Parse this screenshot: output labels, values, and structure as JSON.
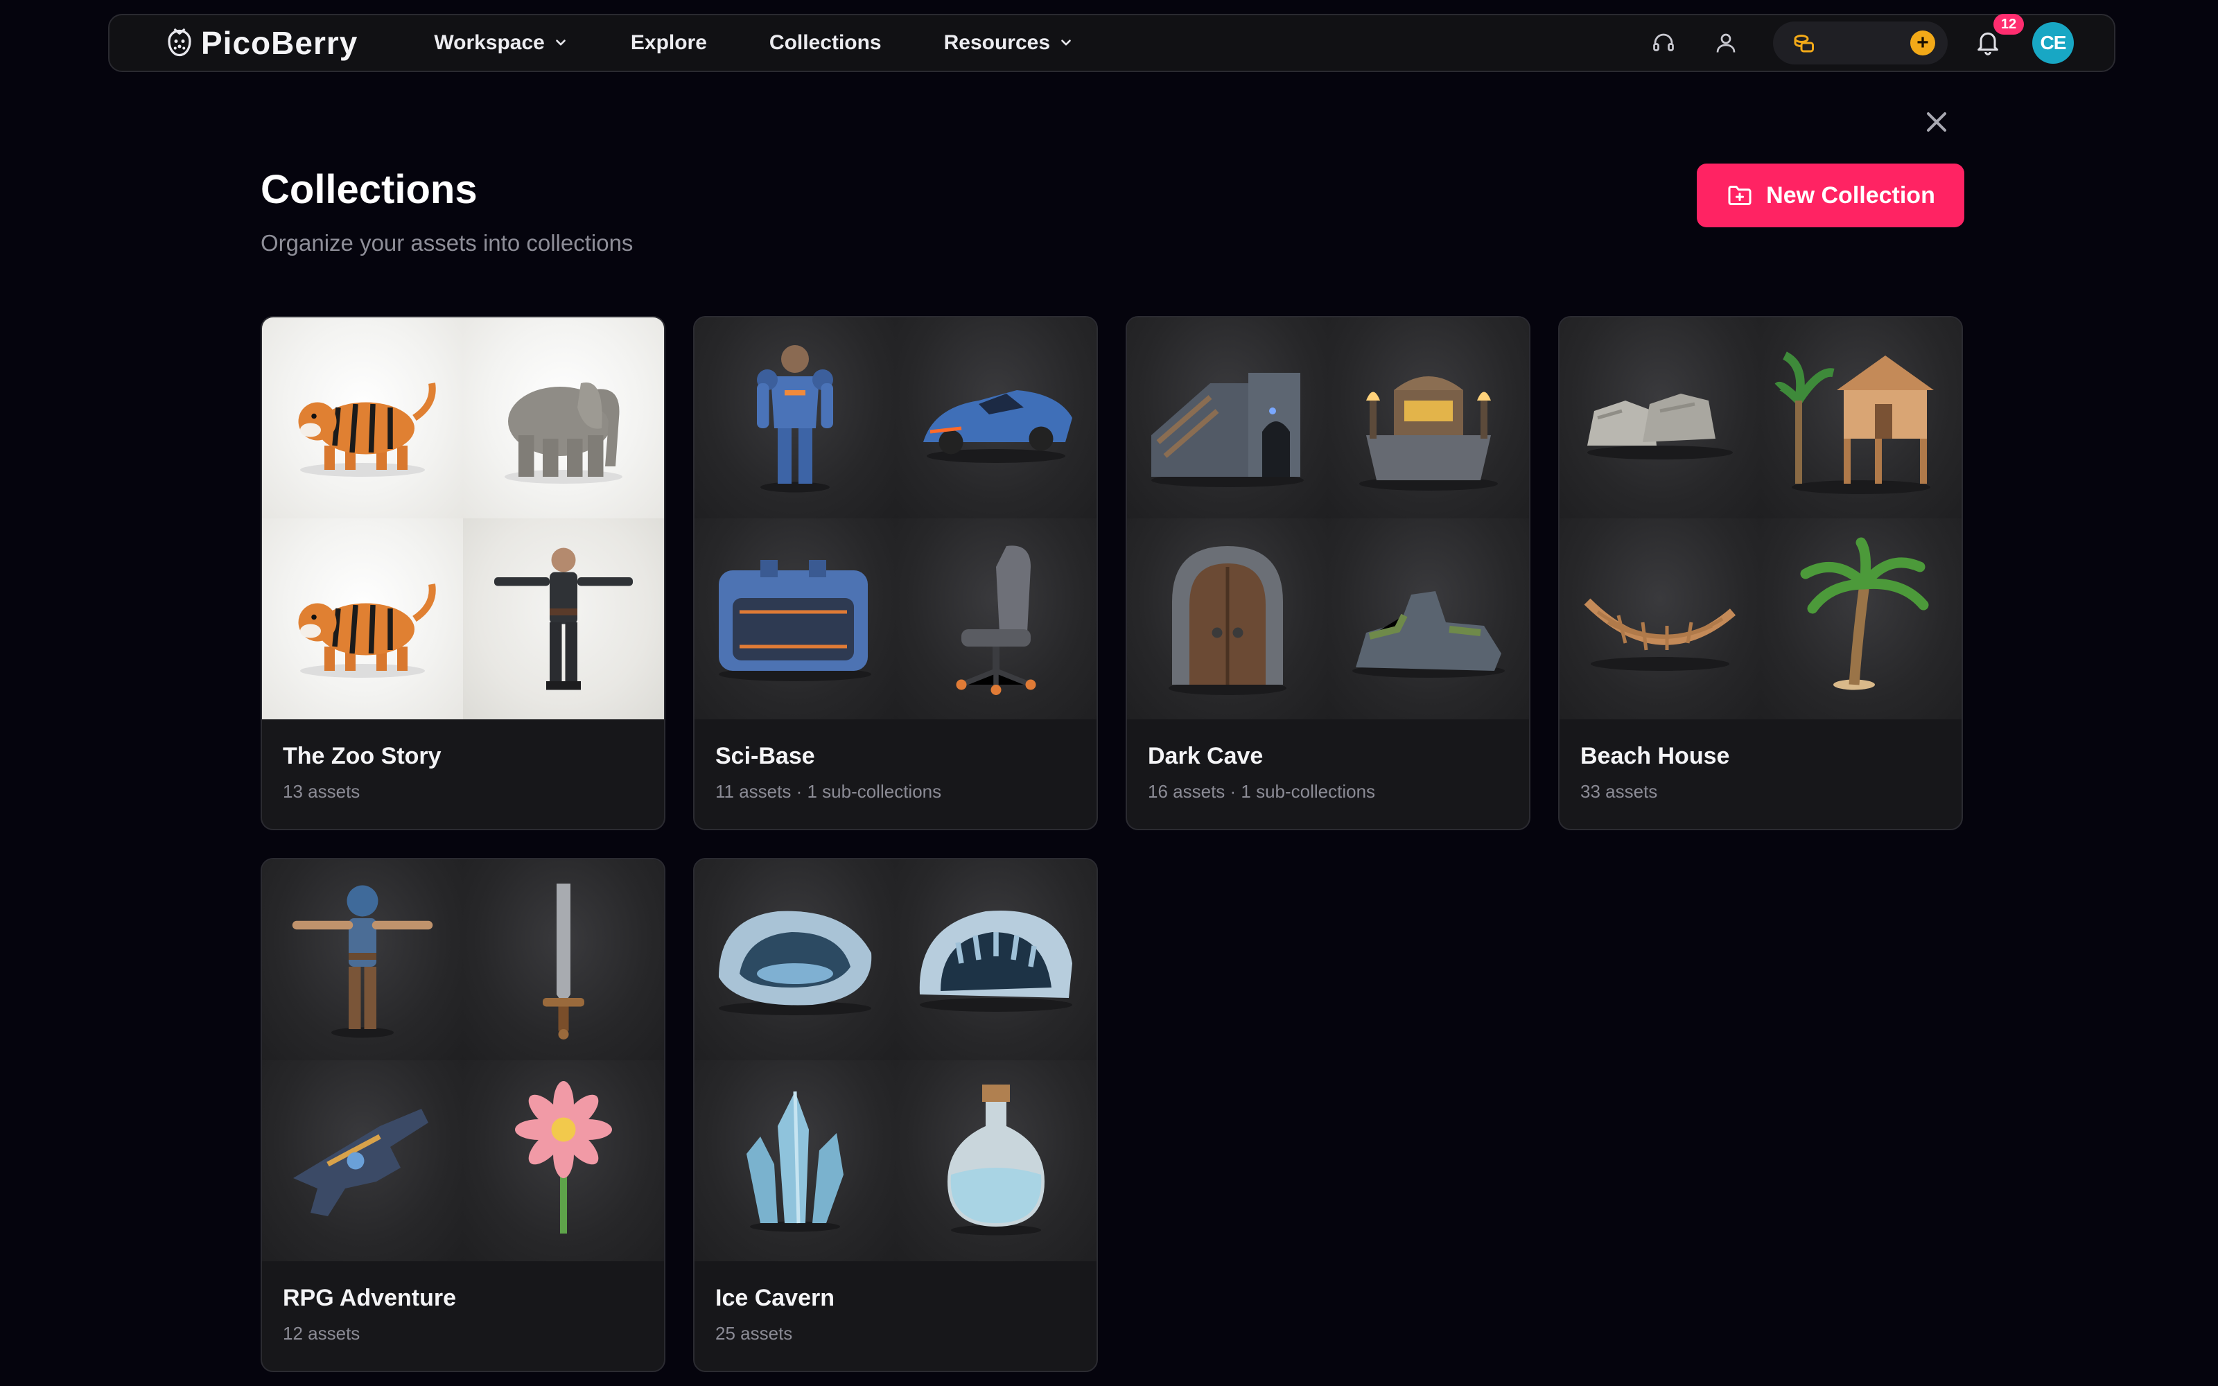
{
  "brand": {
    "name": "PicoBerry"
  },
  "nav": {
    "items": [
      {
        "label": "Workspace",
        "dropdown": true
      },
      {
        "label": "Explore",
        "dropdown": false
      },
      {
        "label": "Collections",
        "dropdown": false
      },
      {
        "label": "Resources",
        "dropdown": true
      }
    ],
    "notifications_count": "12",
    "avatar_initials": "CE"
  },
  "page": {
    "title": "Collections",
    "subtitle": "Organize your assets into collections",
    "new_button_label": "New Collection"
  },
  "colors": {
    "accent": "#ff2363",
    "badge": "#ff2d6f",
    "avatar": "#18a7c4",
    "coin": "#f2a918",
    "background": "#05040d"
  },
  "collections": [
    {
      "title": "The Zoo Story",
      "meta": "13 assets",
      "thumbs": [
        "tiger",
        "elephant",
        "tiger",
        "soldier-character"
      ]
    },
    {
      "title": "Sci-Base",
      "meta": "11 assets · 1 sub-collections",
      "thumbs": [
        "armored-soldier",
        "hover-car",
        "sci-fi-crate",
        "office-chair"
      ]
    },
    {
      "title": "Dark Cave",
      "meta": "16 assets · 1 sub-collections",
      "thumbs": [
        "stone-ruins",
        "treasure-altar",
        "stone-arch-door",
        "mossy-rocks"
      ]
    },
    {
      "title": "Beach House",
      "meta": "33 assets",
      "thumbs": [
        "boulders",
        "stilt-hut",
        "hammock",
        "palm-tree"
      ]
    },
    {
      "title": "RPG Adventure",
      "meta": "12 assets",
      "thumbs": [
        "adventurer-character",
        "sword",
        "blaster-gun",
        "pink-flower"
      ]
    },
    {
      "title": "Ice Cavern",
      "meta": "25 assets",
      "thumbs": [
        "ice-cave",
        "ice-cave-arch",
        "ice-crystal",
        "potion-bottle"
      ]
    }
  ]
}
